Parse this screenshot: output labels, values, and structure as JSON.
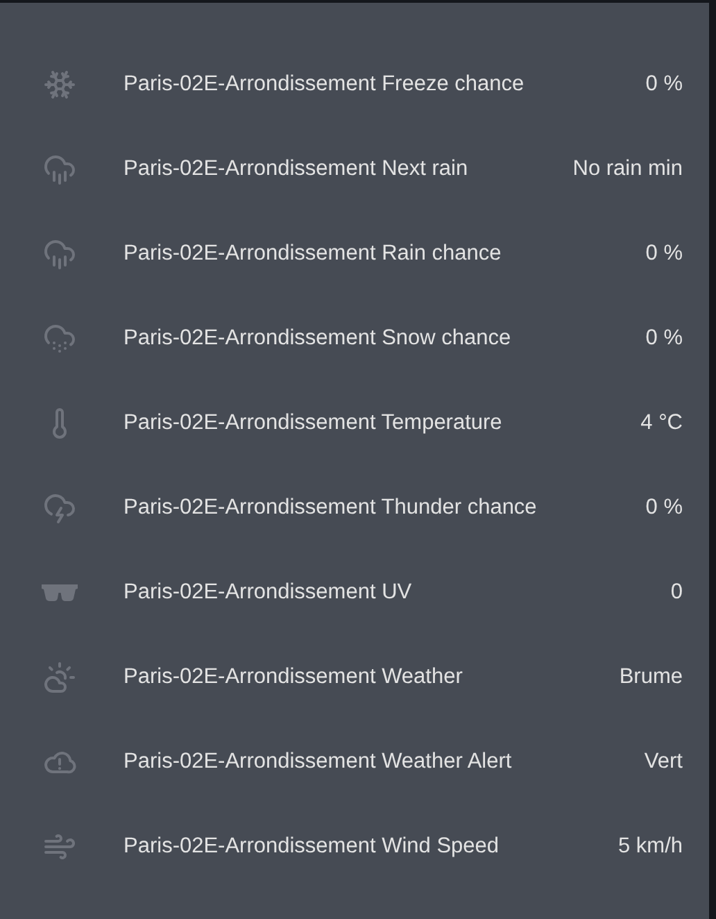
{
  "entities": [
    {
      "kind": "freeze",
      "name": "Paris-02E-Arrondissement Freeze chance",
      "value": "0 %"
    },
    {
      "kind": "rain",
      "name": "Paris-02E-Arrondissement Next rain",
      "value": "No rain min"
    },
    {
      "kind": "rain",
      "name": "Paris-02E-Arrondissement Rain chance",
      "value": "0 %"
    },
    {
      "kind": "snow",
      "name": "Paris-02E-Arrondissement Snow chance",
      "value": "0 %"
    },
    {
      "kind": "temperature",
      "name": "Paris-02E-Arrondissement Temperature",
      "value": "4 °C"
    },
    {
      "kind": "thunder",
      "name": "Paris-02E-Arrondissement Thunder chance",
      "value": "0 %"
    },
    {
      "kind": "uv",
      "name": "Paris-02E-Arrondissement UV",
      "value": "0"
    },
    {
      "kind": "weather",
      "name": "Paris-02E-Arrondissement Weather",
      "value": "Brume"
    },
    {
      "kind": "alert",
      "name": "Paris-02E-Arrondissement Weather Alert",
      "value": "Vert"
    },
    {
      "kind": "wind",
      "name": "Paris-02E-Arrondissement Wind Speed",
      "value": "5 km/h"
    }
  ]
}
